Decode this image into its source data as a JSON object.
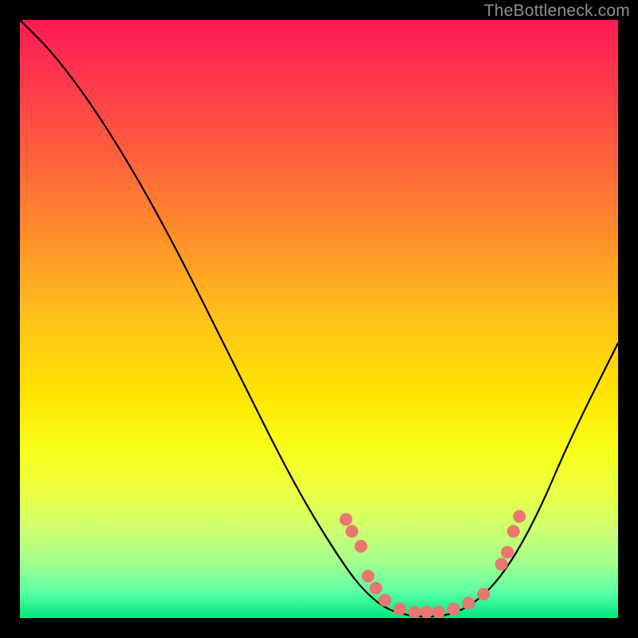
{
  "watermark": "TheBottleneck.com",
  "chart_data": {
    "type": "line",
    "title": "",
    "xlabel": "",
    "ylabel": "",
    "xlim": [
      0,
      100
    ],
    "ylim": [
      0,
      100
    ],
    "grid": false,
    "legend": false,
    "curve": [
      {
        "x": 0,
        "y": 100
      },
      {
        "x": 6,
        "y": 94
      },
      {
        "x": 14,
        "y": 83
      },
      {
        "x": 24,
        "y": 66
      },
      {
        "x": 36,
        "y": 42
      },
      {
        "x": 46,
        "y": 22
      },
      {
        "x": 54,
        "y": 9
      },
      {
        "x": 58,
        "y": 4
      },
      {
        "x": 62,
        "y": 1
      },
      {
        "x": 68,
        "y": 0
      },
      {
        "x": 74,
        "y": 1
      },
      {
        "x": 80,
        "y": 6
      },
      {
        "x": 86,
        "y": 16
      },
      {
        "x": 92,
        "y": 30
      },
      {
        "x": 100,
        "y": 46
      }
    ],
    "markers": [
      {
        "x": 54.5,
        "y": 16.5
      },
      {
        "x": 55.5,
        "y": 14.5
      },
      {
        "x": 57.0,
        "y": 12.0
      },
      {
        "x": 58.2,
        "y": 7.0
      },
      {
        "x": 59.5,
        "y": 5.0
      },
      {
        "x": 61.0,
        "y": 3.0
      },
      {
        "x": 63.5,
        "y": 1.5
      },
      {
        "x": 66.0,
        "y": 1.0
      },
      {
        "x": 68.0,
        "y": 1.0
      },
      {
        "x": 70.0,
        "y": 1.0
      },
      {
        "x": 72.5,
        "y": 1.5
      },
      {
        "x": 75.0,
        "y": 2.5
      },
      {
        "x": 77.5,
        "y": 4.0
      },
      {
        "x": 80.5,
        "y": 9.0
      },
      {
        "x": 81.5,
        "y": 11.0
      },
      {
        "x": 82.5,
        "y": 14.5
      },
      {
        "x": 83.5,
        "y": 17.0
      }
    ],
    "marker_color": "#e9776f",
    "curve_color": "#000000"
  }
}
